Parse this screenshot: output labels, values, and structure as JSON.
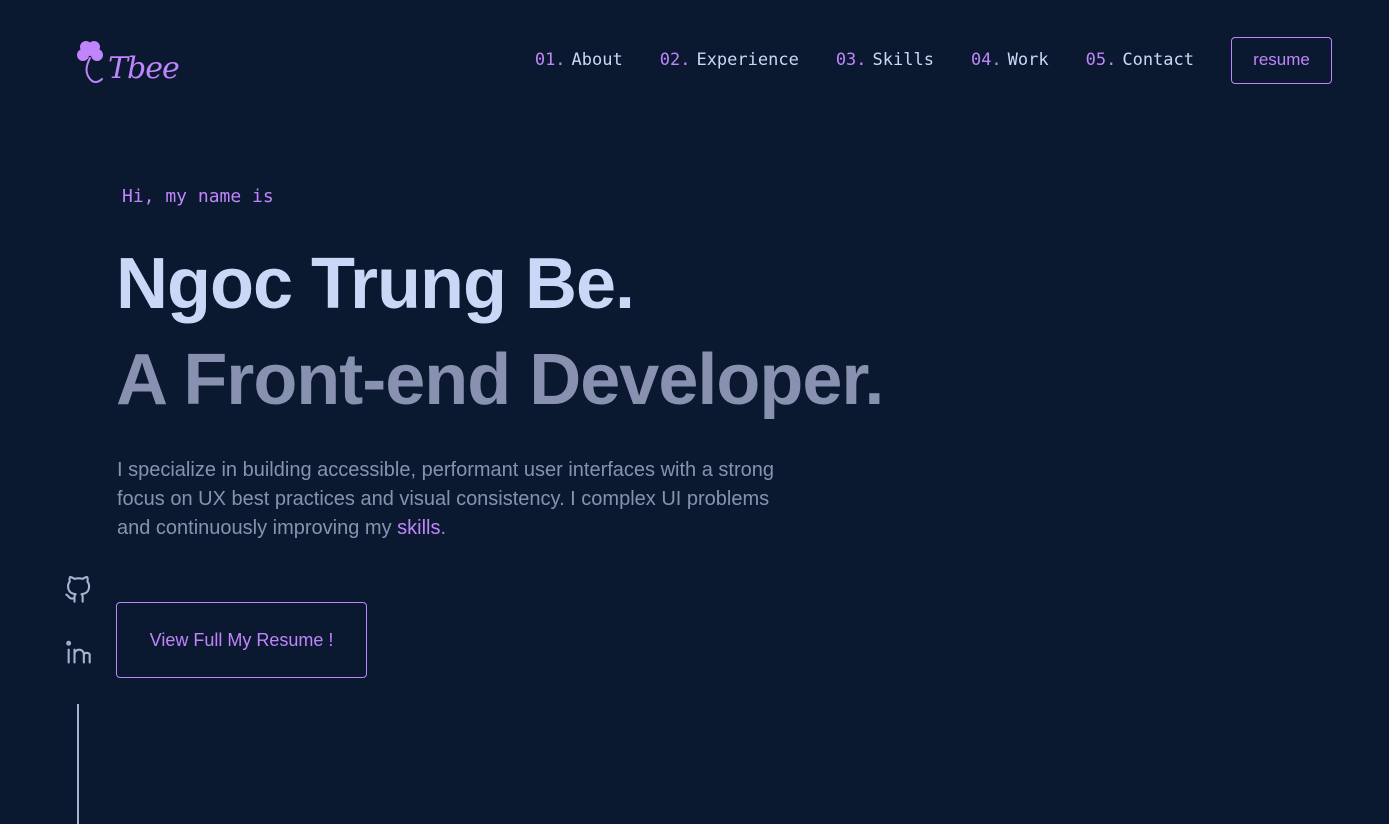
{
  "logo": {
    "text": "Tbee",
    "icon": "clover-icon"
  },
  "nav": {
    "items": [
      {
        "num": "01.",
        "label": "About"
      },
      {
        "num": "02.",
        "label": "Experience"
      },
      {
        "num": "03.",
        "label": "Skills"
      },
      {
        "num": "04.",
        "label": "Work"
      },
      {
        "num": "05.",
        "label": "Contact"
      }
    ],
    "resume_label": "resume"
  },
  "hero": {
    "intro": "Hi, my name is",
    "name": "Ngoc Trung Be.",
    "role": "A Front-end Developer.",
    "description": "I specialize in building accessible, performant user interfaces with a strong focus on UX best practices and visual consistency. I complex UI problems and continuously improving my ",
    "skills_link": "skills",
    "description_end": ".",
    "cta_label": "View Full My Resume !"
  },
  "social": [
    {
      "icon": "github-icon"
    },
    {
      "icon": "linkedin-icon"
    }
  ],
  "colors": {
    "background": "#0a192f",
    "accent": "#c084fc",
    "heading": "#ccd6f6",
    "text": "#8892b0"
  }
}
